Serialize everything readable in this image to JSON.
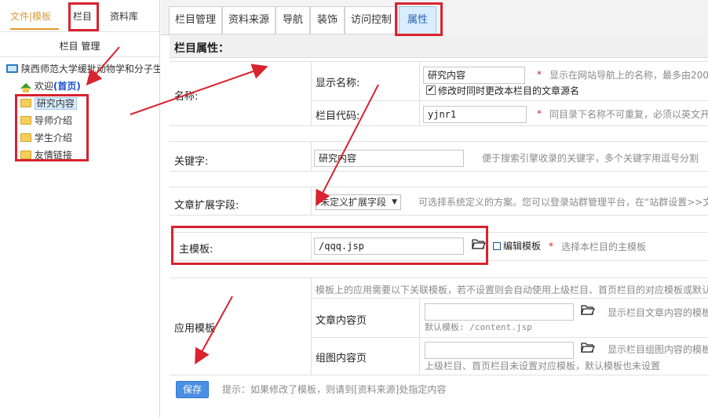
{
  "left": {
    "tabs": [
      "文件|模板",
      "栏目",
      "资料库"
    ],
    "panel_title": "栏目 管理",
    "tree": {
      "root": "陕西师范大学缓批动物学和分子生",
      "home": "欢迎",
      "home_emph": "(首页)",
      "items": [
        "研究内容",
        "导师介绍",
        "学生介绍",
        "友情链接"
      ]
    }
  },
  "tabs": [
    "栏目管理",
    "资料来源",
    "导航",
    "装饰",
    "访问控制",
    "属性"
  ],
  "section_title": "栏目属性：",
  "form": {
    "name_label": "名称:",
    "display_name_label": "显示名称:",
    "display_name_value": "研究内容",
    "display_name_hint": "显示在网站导航上的名称，最多由200个",
    "sync_checkbox_label": "修改时同时更改本栏目的文章源名",
    "code_label": "栏目代码:",
    "code_value": "yjnr1",
    "code_hint": "同目录下名称不可重复，必须以英文开",
    "keywords_label": "关键字:",
    "keywords_value": "研究内容",
    "keywords_hint": "便于搜索引擎收录的关键字，多个关键字用逗号分割",
    "ext_label": "文章扩展字段:",
    "ext_select": "未定义扩展字段",
    "ext_hint": "可选择系统定义的方案。您可以登录站群管理平台，在“站群设置>>文",
    "main_template_label": "主模板:",
    "main_template_value": "/qqq.jsp",
    "edit_template_label": "编辑模板",
    "main_template_hint": "选择本栏目的主模板",
    "app_template_label": "应用模板",
    "app_template_intro": "模板上的应用需要以下关联模板，若不设置则会自动使用上级栏目、首页栏目的对应模板或默认",
    "article_label": "文章内容页",
    "article_default": "默认模板: /content.jsp",
    "article_hint": "显示栏目文章内容的模板",
    "gallery_label": "组图内容页",
    "gallery_default": "上级栏目、首页栏目未设置对应模板，默认模板也未设置",
    "gallery_hint": "显示栏目组图内容的模板",
    "save_label": "保存",
    "save_hint": "提示：如果修改了模板，则请到[资料来源]处指定内容"
  }
}
